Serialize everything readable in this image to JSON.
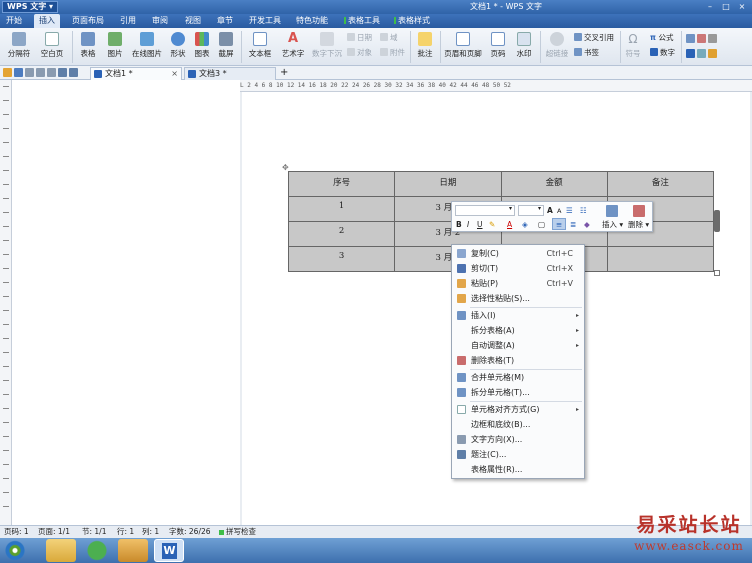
{
  "app": {
    "name": "WPS 文字",
    "document_title": "文档1 * - WPS 文字"
  },
  "menu": [
    "开始",
    "插入",
    "页面布局",
    "引用",
    "审阅",
    "视图",
    "章节",
    "开发工具",
    "特色功能",
    "表格工具",
    "表格样式"
  ],
  "ribbon": {
    "page_break": "分隔符",
    "blank_page": "空白页",
    "table": "表格",
    "picture": "图片",
    "online_picture": "在线图片",
    "shape": "形状",
    "chart": "图表",
    "screenshot": "截屏",
    "textbox": "文本框",
    "art_text": "艺术字",
    "text_below": "数字下沉",
    "date": "日期",
    "field": "域",
    "object": "对象",
    "attachment": "附件",
    "comment": "批注",
    "header_footer": "页眉和页脚",
    "page_number": "页码",
    "watermark": "水印",
    "hyperlink": "超链接",
    "cross_ref": "交叉引用",
    "bookmark": "书签",
    "symbol": "符号",
    "formula": "公式",
    "number": "数字"
  },
  "tabs": [
    {
      "label": "文档1 *",
      "close": "×"
    },
    {
      "label": "文档3 *",
      "close": ""
    }
  ],
  "new_tab": "+",
  "ruler_text": "L  2  4  6  8  10  12  14  16  18  20  22  24  26  28  30  32  34  36  38  40  42  44  46  48  50  52",
  "table": {
    "headers": [
      "序号",
      "日期",
      "金额",
      "备注"
    ],
    "rows": [
      [
        "1",
        "3 月 1",
        "",
        ""
      ],
      [
        "2",
        "3 月 2",
        "",
        ""
      ],
      [
        "3",
        "3 月 3",
        "",
        ""
      ]
    ]
  },
  "mini_toolbar": {
    "grow_font": "A",
    "shrink_font": "A",
    "bold": "B",
    "italic": "I",
    "underline": "U",
    "font_color": "A",
    "insert": "插入",
    "delete": "删除"
  },
  "context_menu": [
    {
      "label": "复制(C)",
      "shortcut": "Ctrl+C",
      "icon": "copy-icon"
    },
    {
      "label": "剪切(T)",
      "shortcut": "Ctrl+X",
      "icon": "cut-icon"
    },
    {
      "label": "粘贴(P)",
      "shortcut": "Ctrl+V",
      "icon": "paste-icon"
    },
    {
      "label": "选择性粘贴(S)...",
      "shortcut": "",
      "icon": "paste-special-icon"
    },
    {
      "label": "插入(I)",
      "shortcut": "",
      "icon": "insert-icon",
      "submenu": true
    },
    {
      "label": "拆分表格(A)",
      "shortcut": "",
      "submenu": true
    },
    {
      "label": "自动调整(A)",
      "shortcut": "",
      "submenu": true
    },
    {
      "label": "删除表格(T)",
      "shortcut": "",
      "icon": "delete-table-icon"
    },
    {
      "label": "合并单元格(M)",
      "shortcut": "",
      "icon": "merge-cells-icon"
    },
    {
      "label": "拆分单元格(T)...",
      "shortcut": "",
      "icon": "split-cells-icon"
    },
    {
      "label": "单元格对齐方式(G)",
      "shortcut": "",
      "icon": "cell-align-icon",
      "submenu": true
    },
    {
      "label": "边框和底纹(B)...",
      "shortcut": ""
    },
    {
      "label": "文字方向(X)...",
      "shortcut": "",
      "icon": "text-direction-icon"
    },
    {
      "label": "题注(C)...",
      "shortcut": "",
      "icon": "caption-icon"
    },
    {
      "label": "表格属性(R)...",
      "shortcut": ""
    }
  ],
  "status": {
    "page": "页码: 1",
    "pages": "页面: 1/1",
    "section": "节: 1/1",
    "row": "行: 1",
    "col": "列: 1",
    "words": "字数: 26/26",
    "spellcheck": "拼写检查"
  },
  "watermark": {
    "text": "易采站长站",
    "url": "www.easck.com"
  },
  "colors": {
    "title_bar": "#2f63a8",
    "table_shading": "#c8c8c8",
    "watermark": "#c0392b"
  }
}
